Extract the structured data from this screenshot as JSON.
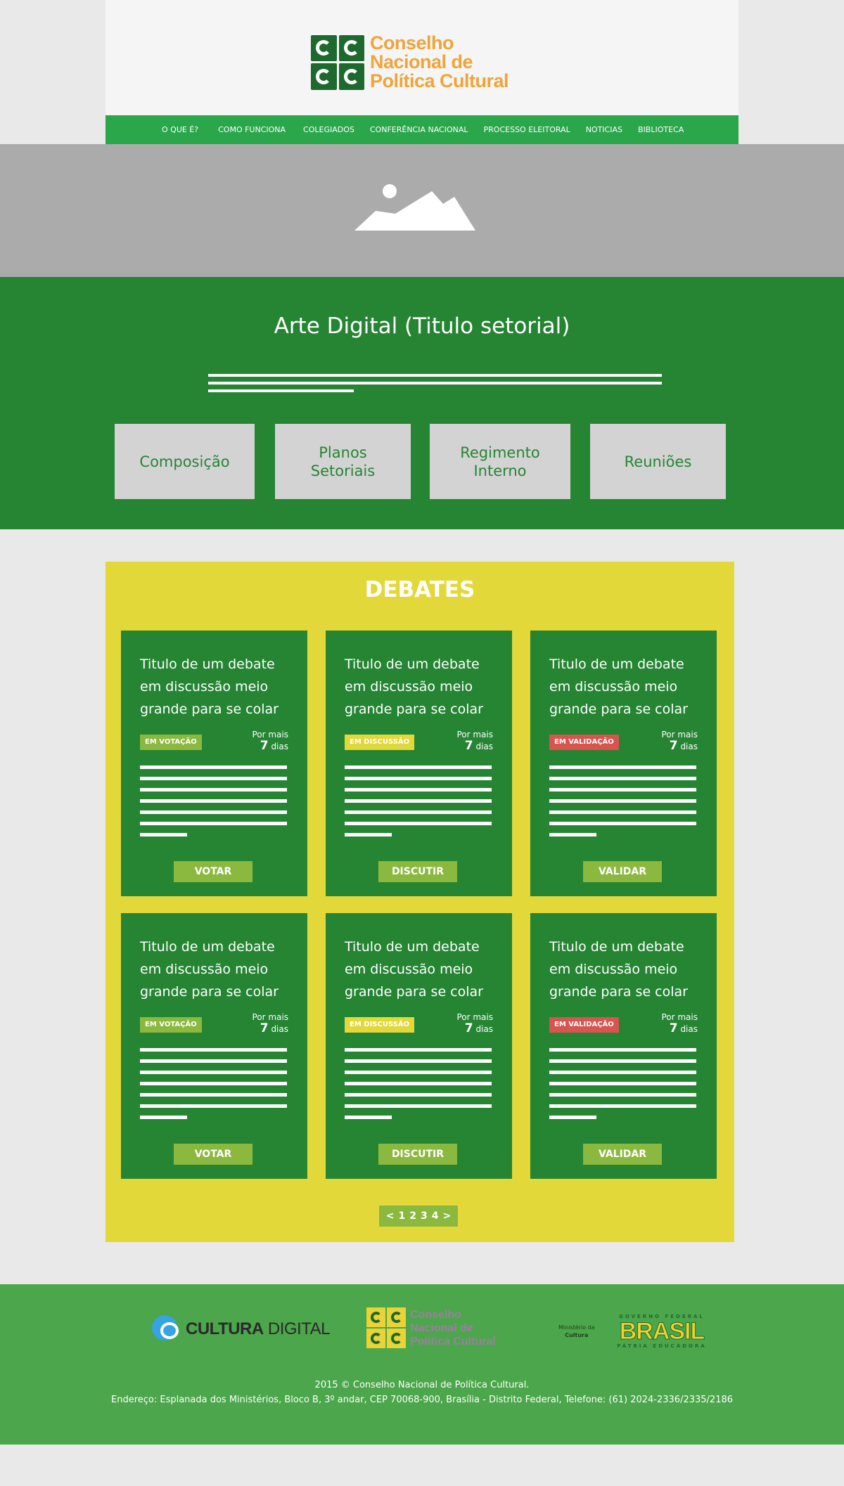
{
  "header": {
    "org_name_line1": "Conselho",
    "org_name_line2": "Nacional de",
    "org_name_line3": "Política Cultural"
  },
  "nav": {
    "items": [
      {
        "label": "O QUE É?"
      },
      {
        "label": "COMO FUNCIONA"
      },
      {
        "label": "COLEGIADOS"
      },
      {
        "label": "CONFERÊNCIA NACIONAL"
      },
      {
        "label": "PROCESSO ELEITORAL"
      },
      {
        "label": "NOTICIAS"
      },
      {
        "label": "BIBLIOTECA"
      }
    ]
  },
  "sector": {
    "title": "Arte Digital (Titulo setorial)",
    "buttons": [
      {
        "label": "Composição"
      },
      {
        "label": "Planos Setoriais"
      },
      {
        "label": "Regimento Interno"
      },
      {
        "label": "Reuniões"
      }
    ]
  },
  "debates": {
    "title": "DEBATES",
    "days_prefix": "Por mais",
    "days_value": "7",
    "days_suffix": "dias",
    "cards": [
      {
        "title": "Titulo de um debate em discussão meio grande para se colar",
        "status": "EM VOTAÇÃO",
        "action": "VOTAR"
      },
      {
        "title": "Titulo de um debate em discussão meio grande para se colar",
        "status": "EM DISCUSSÃO",
        "action": "DISCUTIR"
      },
      {
        "title": "Titulo de um debate em discussão meio grande para se colar",
        "status": "EM VALIDAÇÃO",
        "action": "VALIDAR"
      },
      {
        "title": "Titulo de um debate em discussão meio grande para se colar",
        "status": "EM VOTAÇÃO",
        "action": "VOTAR"
      },
      {
        "title": "Titulo de um debate em discussão meio grande para se colar",
        "status": "EM DISCUSSÃO",
        "action": "DISCUTIR"
      },
      {
        "title": "Titulo de um debate em discussão meio grande para se colar",
        "status": "EM VALIDAÇÃO",
        "action": "VALIDAR"
      }
    ],
    "pager": {
      "prev": "<",
      "pages": [
        "1",
        "2",
        "3",
        "4"
      ],
      "next": ">"
    }
  },
  "footer": {
    "cultura_digital_bold": "CULTURA",
    "cultura_digital_light": "DIGITAL",
    "cnpc_line1": "Conselho",
    "cnpc_line2": "Nacional de",
    "cnpc_line3": "Política Cultural",
    "ministerio_line1": "Ministério da",
    "ministerio_line2": "Cultura",
    "gov_top": "GOVERNO FEDERAL",
    "gov_mid": "BRASIL",
    "gov_bot": "PÁTRIA EDUCADORA",
    "copyright": "2015 © Conselho Nacional de Política Cultural.",
    "address": "Endereço: Esplanada dos Ministérios, Bloco B, 3º andar, CEP 70068-900, Brasília - Distrito Federal, Telefone: (61) 2024-2336/2335/2186"
  },
  "colors": {
    "green_dark": "#258533",
    "green_nav": "#2aa64b",
    "green_light": "#8bb83f",
    "yellow": "#e3d83a",
    "orange": "#f0a43a",
    "red": "#d9534f",
    "gray_hero": "#ababab"
  }
}
